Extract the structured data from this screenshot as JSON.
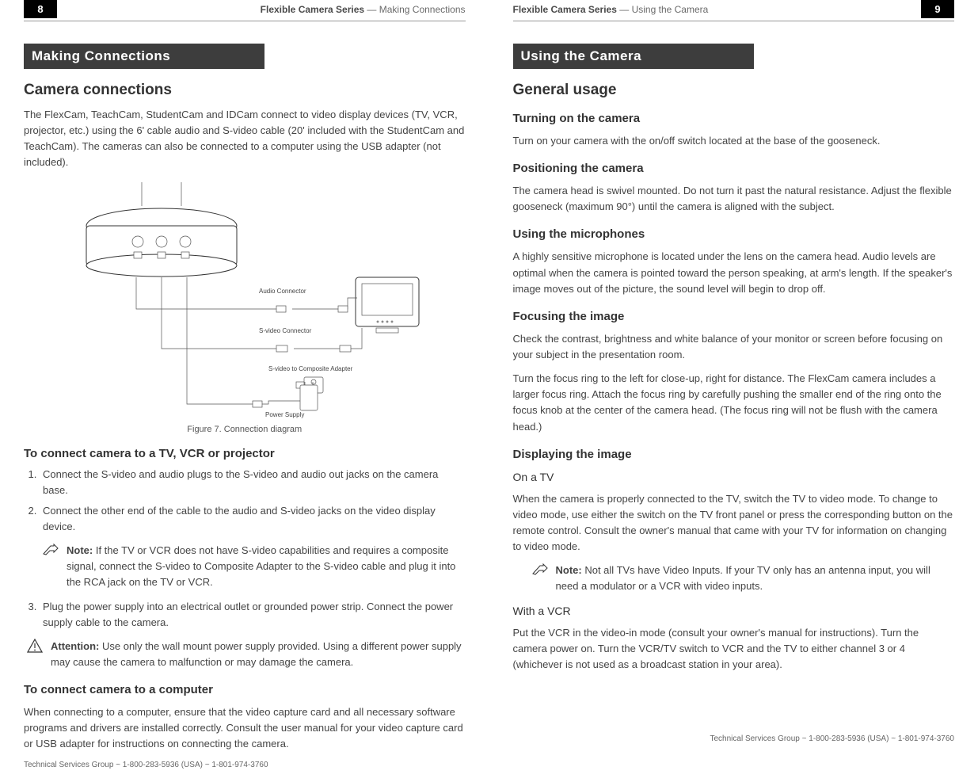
{
  "left": {
    "page_num": "8",
    "header_series": "Flexible Camera Series",
    "header_sep": " — ",
    "header_section": "Making Connections",
    "section_bar": "Making Connections",
    "h2_1": "Camera connections",
    "intro": "The FlexCam, TeachCam, StudentCam and IDCam connect to video display devices (TV, VCR, projector, etc.) using the 6' cable audio and S-video cable (20' included with the StudentCam and TeachCam). The cameras can also be connected to a computer using the USB adapter (not included).",
    "diagram_labels": {
      "audio": "Audio Connector",
      "svideo": "S-video Connector",
      "adapter": "S-video to Composite Adapter",
      "power": "Power Supply"
    },
    "fig_caption": "Figure 7. Connection diagram",
    "h3_connect_tv": "To connect camera to a TV, VCR or projector",
    "steps_tv": {
      "s1": "Connect the S-video and audio plugs to the S-video and audio out jacks on the camera base.",
      "s2": "Connect the other end of the cable to the audio and S-video jacks on the video display device."
    },
    "note_tv": {
      "lead": "Note:",
      "body": "If the TV or VCR does not have S-video capabilities and requires a composite signal, connect the S-video to Composite Adapter to the S-video cable and plug it into the RCA jack on the TV or VCR."
    },
    "steps_tv_cont": {
      "s3": "Plug the power supply into an electrical outlet or grounded power strip. Connect the power supply cable to the camera."
    },
    "attention": {
      "lead": "Attention:",
      "body": "Use only the wall mount power supply provided. Using a different power supply may cause the camera to malfunction or may damage the camera."
    },
    "h3_connect_pc": "To connect camera to a computer",
    "pc_body": "When connecting to a computer, ensure that the video capture card and all necessary software programs and drivers are installed correctly. Consult the user manual for your video capture card or USB adapter for instructions on connecting the camera.",
    "footer": "Technical Services Group ~ 1-800-283-5936 (USA) ~ 1-801-974-3760"
  },
  "right": {
    "page_num": "9",
    "header_series": "Flexible Camera Series",
    "header_sep": " — ",
    "header_section": "Using the Camera",
    "section_bar": "Using the Camera",
    "h2_1": "General usage",
    "h3_turning": "Turning on the camera",
    "turning_body": "Turn on your camera with the on/off switch located at the base of the gooseneck.",
    "h3_position": "Positioning the camera",
    "position_body": "The camera head is swivel mounted. Do not turn it past the natural resistance. Adjust the flexible gooseneck (maximum 90°) until the camera is aligned with the subject.",
    "h3_mic": "Using the microphones",
    "mic_body": "A highly sensitive microphone is located under the lens on the camera head. Audio levels are optimal when the camera is pointed toward the person speaking, at arm's length. If the speaker's image moves out of the picture, the sound level will begin to drop off.",
    "h3_focus": "Focusing the image",
    "focus_body1": "Check the contrast, brightness and white balance of your monitor or screen before focusing on your subject in the presentation room.",
    "focus_body2": "Turn the focus ring to the left for close-up, right for distance. The FlexCam camera includes a larger focus ring. Attach the focus ring by carefully pushing the smaller end of the ring onto the focus knob at the center of the camera head. (The focus ring will not be flush with the camera head.)",
    "h3_display": "Displaying the image",
    "h4_tv": "On a TV",
    "tv_body": "When the camera is properly connected to the TV, switch the TV to video mode. To change to video mode, use either the switch on the TV front panel or press the corresponding button on the remote control. Consult the owner's manual that came with your TV for information on changing to video mode.",
    "note_tv2": {
      "lead": "Note:",
      "body": "Not all TVs have Video Inputs. If your TV only has an antenna input, you will need a modulator or a VCR with video inputs."
    },
    "h4_vcr": "With a VCR",
    "vcr_body": "Put the VCR in the video-in mode (consult your owner's manual for instructions). Turn the camera power on. Turn the VCR/TV switch to VCR and the TV to either channel 3 or 4 (whichever is not used as a broadcast station in your area).",
    "footer": "Technical Services Group ~ 1-800-283-5936 (USA) ~ 1-801-974-3760"
  }
}
